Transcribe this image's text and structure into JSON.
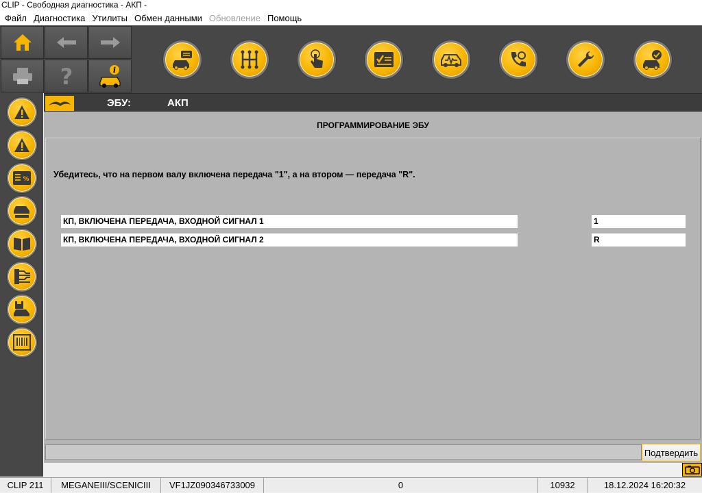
{
  "window": {
    "title": "CLIP - Свободная диагностика - АКП -"
  },
  "menu": [
    {
      "label": "Файл",
      "enabled": true
    },
    {
      "label": "Диагностика",
      "enabled": true
    },
    {
      "label": "Утилиты",
      "enabled": true
    },
    {
      "label": "Обмен данными",
      "enabled": true
    },
    {
      "label": "Обновление",
      "enabled": false
    },
    {
      "label": "Помощь",
      "enabled": true
    }
  ],
  "toolbar": {
    "nav_icons": [
      "home-icon",
      "back-arrow-icon",
      "forward-arrow-icon",
      "printer-icon",
      "help-question-icon",
      "vehicle-info-icon"
    ],
    "function_icons": [
      "vehicle-identification-icon",
      "gearbox-icon",
      "touch-test-icon",
      "checklist-icon",
      "vehicle-diagnostic-icon",
      "phone-support-icon",
      "wrench-icon",
      "vehicle-check-icon"
    ]
  },
  "sidebar": {
    "icons": [
      "fault-warning-icon",
      "fault-warning-icon-2",
      "parameters-icon",
      "vehicle-states-icon",
      "documentation-book-icon",
      "wiring-diagram-icon",
      "save-vehicle-icon",
      "barcode-icon"
    ]
  },
  "ecu": {
    "label": "ЭБУ:",
    "value": "АКП"
  },
  "section": {
    "title": "ПРОГРАММИРОВАНИЕ ЭБУ",
    "instruction": "Убедитесь, что на первом валу включена передача \"1\", а на втором — передача \"R\"."
  },
  "parameters": [
    {
      "label": "КП, ВКЛЮЧЕНА ПЕРЕДАЧА, ВХОДНОЙ СИГНАЛ 1",
      "value": "1"
    },
    {
      "label": "КП, ВКЛЮЧЕНА ПЕРЕДАЧА, ВХОДНОЙ СИГНАЛ 2",
      "value": "R"
    }
  ],
  "buttons": {
    "confirm": "Подтвердить"
  },
  "statusbar": {
    "clip": "CLIP 211",
    "vehicle": "MEGANEIII/SCENICIII",
    "vin": "VF1JZ090346733009",
    "counter": "0",
    "code": "10932",
    "datetime": "18.12.2024 16:20:32"
  },
  "colors": {
    "accent": "#f7b500",
    "toolbar": "#474747",
    "panel": "#b4b4b4",
    "ecu_bar": "#3c3c3c"
  }
}
